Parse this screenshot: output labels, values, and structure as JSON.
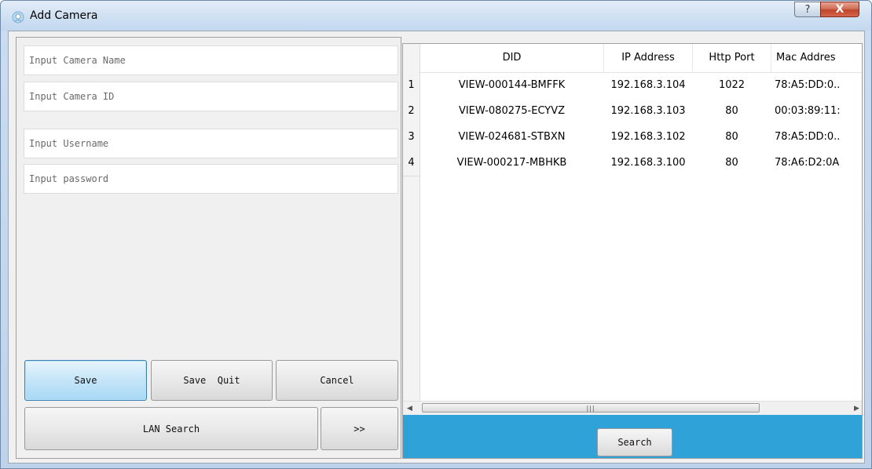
{
  "window": {
    "title": "Add Camera",
    "help_label": "?",
    "close_label": "X"
  },
  "form": {
    "camera_name": {
      "placeholder": "Input Camera Name",
      "value": ""
    },
    "camera_id": {
      "placeholder": "Input Camera ID",
      "value": ""
    },
    "username": {
      "placeholder": "Input Username",
      "value": ""
    },
    "password": {
      "placeholder": "Input password",
      "value": ""
    }
  },
  "buttons": {
    "save": "Save",
    "save_quit": "Save  Quit",
    "cancel": "Cancel",
    "lan_search": "LAN Search",
    "expand": ">>",
    "search": "Search"
  },
  "table": {
    "columns": [
      "DID",
      "IP Address",
      "Http Port",
      "Mac Addres"
    ],
    "rows": [
      {
        "index": "1",
        "did": "VIEW-000144-BMFFK",
        "ip": "192.168.3.104",
        "port": "1022",
        "mac": "78:A5:DD:0.."
      },
      {
        "index": "2",
        "did": "VIEW-080275-ECYVZ",
        "ip": "192.168.3.103",
        "port": "80",
        "mac": "00:03:89:11:"
      },
      {
        "index": "3",
        "did": "VIEW-024681-STBXN",
        "ip": "192.168.3.102",
        "port": "80",
        "mac": "78:A5:DD:0.."
      },
      {
        "index": "4",
        "did": "VIEW-000217-MBHKB",
        "ip": "192.168.3.100",
        "port": "80",
        "mac": "78:A6:D2:0A"
      }
    ],
    "scroll_left": "◀",
    "scroll_right": "▶",
    "scroll_grip": "|||"
  },
  "icons": {
    "app": "camera-app-icon",
    "help": "help-icon",
    "close": "close-icon"
  },
  "colors": {
    "accent_strip": "#2fa2d8",
    "close_button": "#c0452a"
  }
}
